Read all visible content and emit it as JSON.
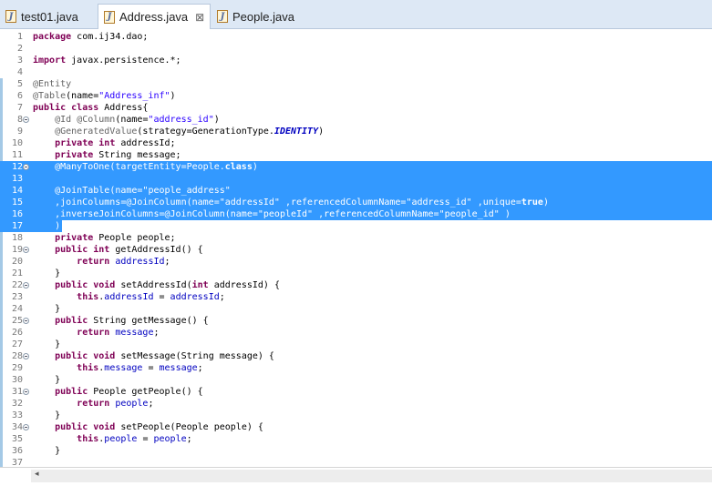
{
  "tabs": [
    {
      "label": "test01.java",
      "icon": "java-file-icon",
      "active": false
    },
    {
      "label": "Address.java",
      "icon": "java-file-icon",
      "active": true,
      "close": "⊠"
    },
    {
      "label": "People.java",
      "icon": "java-file-icon",
      "active": false
    }
  ],
  "editor": {
    "selection_color": "#3399ff",
    "selected_lines": [
      12,
      13,
      14,
      15,
      16,
      17
    ],
    "lines": [
      {
        "n": "1",
        "text": "package com.ij34.dao;",
        "fold": false
      },
      {
        "n": "2",
        "text": "",
        "fold": false
      },
      {
        "n": "3",
        "text": "import javax.persistence.*;",
        "fold": false
      },
      {
        "n": "4",
        "text": "",
        "fold": false
      },
      {
        "n": "5",
        "text": "@Entity",
        "fold": false
      },
      {
        "n": "6",
        "text": "@Table(name=\"Address_inf\")",
        "fold": false
      },
      {
        "n": "7",
        "text": "public class Address{",
        "fold": false
      },
      {
        "n": "8",
        "text": "    @Id @Column(name=\"address_id\")",
        "fold": true
      },
      {
        "n": "9",
        "text": "    @GeneratedValue(strategy=GenerationType.IDENTITY)",
        "fold": false
      },
      {
        "n": "10",
        "text": "    private int addressId;",
        "fold": false
      },
      {
        "n": "11",
        "text": "    private String message;",
        "fold": false
      },
      {
        "n": "12",
        "text": "    @ManyToOne(targetEntity=People.class)",
        "fold": true
      },
      {
        "n": "13",
        "text": "",
        "fold": false
      },
      {
        "n": "14",
        "text": "    @JoinTable(name=\"people_address\"",
        "fold": false
      },
      {
        "n": "15",
        "text": "    ,joinColumns=@JoinColumn(name=\"addressId\" ,referencedColumnName=\"address_id\" ,unique=true)",
        "fold": false
      },
      {
        "n": "16",
        "text": "    ,inverseJoinColumns=@JoinColumn(name=\"peopleId\" ,referencedColumnName=\"people_id\" )",
        "fold": false
      },
      {
        "n": "17",
        "text": "    )",
        "fold": false
      },
      {
        "n": "18",
        "text": "    private People people;",
        "fold": false
      },
      {
        "n": "19",
        "text": "    public int getAddressId() {",
        "fold": true
      },
      {
        "n": "20",
        "text": "        return addressId;",
        "fold": false
      },
      {
        "n": "21",
        "text": "    }",
        "fold": false
      },
      {
        "n": "22",
        "text": "    public void setAddressId(int addressId) {",
        "fold": true
      },
      {
        "n": "23",
        "text": "        this.addressId = addressId;",
        "fold": false
      },
      {
        "n": "24",
        "text": "    }",
        "fold": false
      },
      {
        "n": "25",
        "text": "    public String getMessage() {",
        "fold": true
      },
      {
        "n": "26",
        "text": "        return message;",
        "fold": false
      },
      {
        "n": "27",
        "text": "    }",
        "fold": false
      },
      {
        "n": "28",
        "text": "    public void setMessage(String message) {",
        "fold": true
      },
      {
        "n": "29",
        "text": "        this.message = message;",
        "fold": false
      },
      {
        "n": "30",
        "text": "    }",
        "fold": false
      },
      {
        "n": "31",
        "text": "    public People getPeople() {",
        "fold": true
      },
      {
        "n": "32",
        "text": "        return people;",
        "fold": false
      },
      {
        "n": "33",
        "text": "    }",
        "fold": false
      },
      {
        "n": "34",
        "text": "    public void setPeople(People people) {",
        "fold": true
      },
      {
        "n": "35",
        "text": "        this.people = people;",
        "fold": false
      },
      {
        "n": "36",
        "text": "    }",
        "fold": false
      },
      {
        "n": "37",
        "text": "",
        "fold": false
      }
    ]
  },
  "scrollbar": {
    "left_arrow": "◂"
  }
}
